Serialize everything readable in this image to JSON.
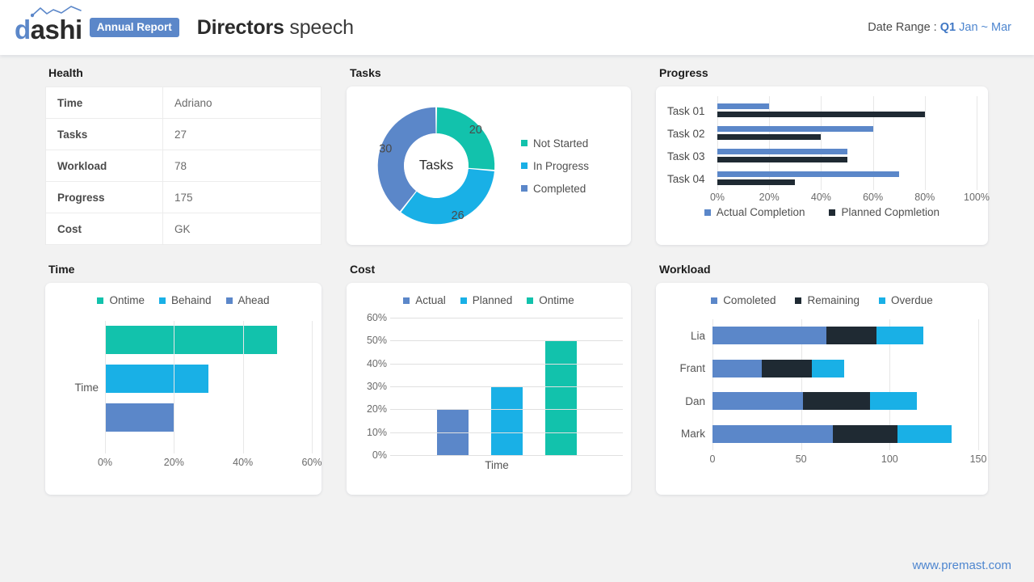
{
  "header": {
    "logo_text_d": "d",
    "logo_text_rest": "ashi",
    "logo_icon": "sparkline-icon",
    "badge": "Annual Report",
    "title_bold": "Directors",
    "title_rest": " speech",
    "date_label": "Date Range :",
    "date_quarter": "Q1",
    "date_range": "Jan ~ Mar"
  },
  "health": {
    "title": "Health",
    "rows": [
      {
        "key": "Time",
        "value": "Adriano"
      },
      {
        "key": "Tasks",
        "value": "27"
      },
      {
        "key": "Workload",
        "value": "78"
      },
      {
        "key": "Progress",
        "value": "175"
      },
      {
        "key": "Cost",
        "value": "GK"
      }
    ]
  },
  "tasks": {
    "title": "Tasks",
    "center_label": "Tasks"
  },
  "progress": {
    "title": "Progress"
  },
  "time": {
    "title": "Time"
  },
  "cost": {
    "title": "Cost"
  },
  "workload": {
    "title": "Workload"
  },
  "footer": {
    "url": "www.premast.com"
  },
  "colors": {
    "teal": "#12c2ac",
    "cyan": "#19b0e6",
    "slate_blue": "#5b87c9",
    "dark_navy": "#1f2a33",
    "brand_blue": "#5b87c9",
    "link_blue": "#4e86cf",
    "page_bg": "#f2f2f2",
    "card_bg": "#ffffff"
  },
  "chart_data": [
    {
      "type": "pie",
      "name": "tasks-donut",
      "title": "Tasks",
      "center_label": "Tasks",
      "labels": [
        "Not Started",
        "In Progress",
        "Completed"
      ],
      "values": [
        20,
        26,
        30
      ],
      "colors": [
        "#12c2ac",
        "#19b0e6",
        "#5b87c9"
      ],
      "data_labels": [
        "20",
        "26",
        "30"
      ],
      "legend": "right",
      "donut": true
    },
    {
      "type": "bar",
      "name": "progress-bars",
      "title": "Progress",
      "orientation": "horizontal",
      "categories": [
        "Task 01",
        "Task 02",
        "Task 03",
        "Task 04"
      ],
      "series": [
        {
          "name": "Actual Completion",
          "values": [
            20,
            60,
            50,
            70
          ],
          "color": "#5b87c9"
        },
        {
          "name": "Planned Copmletion",
          "values": [
            80,
            40,
            50,
            30
          ],
          "color": "#1f2a33"
        }
      ],
      "xticks": [
        "0%",
        "20%",
        "40%",
        "60%",
        "80%",
        "100%"
      ],
      "xlim": [
        0,
        100
      ],
      "grid": true,
      "legend": "bottom"
    },
    {
      "type": "bar",
      "name": "time-bars",
      "title": "Time",
      "orientation": "horizontal",
      "categories": [
        "Time"
      ],
      "series": [
        {
          "name": "Ontime",
          "values": [
            50
          ],
          "color": "#12c2ac"
        },
        {
          "name": "Behaind",
          "values": [
            30
          ],
          "color": "#19b0e6"
        },
        {
          "name": "Ahead",
          "values": [
            20
          ],
          "color": "#5b87c9"
        }
      ],
      "xticks": [
        "0%",
        "20%",
        "40%",
        "60%"
      ],
      "xlim": [
        0,
        60
      ],
      "grid": true,
      "legend": "top"
    },
    {
      "type": "bar",
      "name": "cost-bars",
      "title": "Cost",
      "orientation": "vertical",
      "categories": [
        "Time"
      ],
      "series": [
        {
          "name": "Actual",
          "values": [
            20
          ],
          "color": "#5b87c9"
        },
        {
          "name": "Planned",
          "values": [
            30
          ],
          "color": "#19b0e6"
        },
        {
          "name": "Ontime",
          "values": [
            50
          ],
          "color": "#12c2ac"
        }
      ],
      "yticks": [
        "0%",
        "10%",
        "20%",
        "30%",
        "40%",
        "50%",
        "60%"
      ],
      "ylim": [
        0,
        60
      ],
      "xlabel": "Time",
      "grid": true,
      "legend": "top"
    },
    {
      "type": "bar",
      "name": "workload-stacked",
      "title": "Workload",
      "orientation": "horizontal",
      "stacked": true,
      "categories": [
        "Lia",
        "Frant",
        "Dan",
        "Mark"
      ],
      "series": [
        {
          "name": "Comoleted",
          "values": [
            53,
            23,
            42,
            56
          ],
          "color": "#5b87c9"
        },
        {
          "name": "Remaining",
          "values": [
            23,
            23,
            31,
            30
          ],
          "color": "#1f2a33"
        },
        {
          "name": "Overdue",
          "values": [
            22,
            15,
            22,
            25
          ],
          "color": "#19b0e6"
        }
      ],
      "xticks": [
        "0",
        "50",
        "100",
        "150"
      ],
      "xlim": [
        0,
        150
      ],
      "grid": true,
      "legend": "top"
    }
  ]
}
